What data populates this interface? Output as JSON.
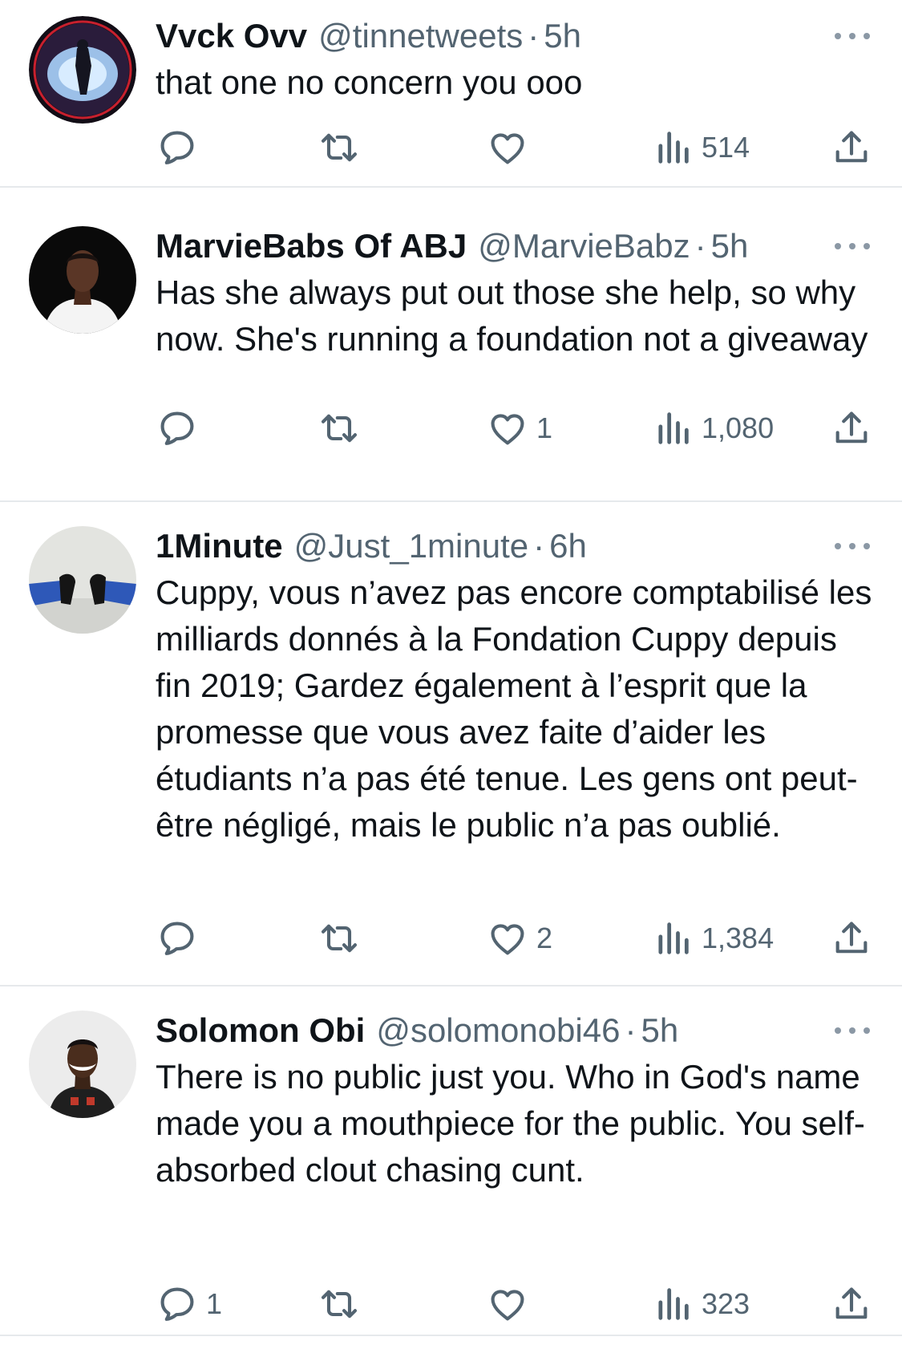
{
  "tweets": [
    {
      "name": "Vvck Ovv",
      "handle": "@tinnetweets",
      "separator": "·",
      "time": "5h",
      "text": "that one no concern you ooo",
      "replies": "",
      "retweets": "",
      "likes": "",
      "views": "514"
    },
    {
      "name": "MarvieBabs Of ABJ",
      "handle": "@MarvieBabz",
      "separator": "·",
      "time": "5h",
      "text": "Has she always put out those she help, so why now. She's running a foundation not a giveaway",
      "replies": "",
      "retweets": "",
      "likes": "1",
      "views": "1,080"
    },
    {
      "name": "1Minute",
      "handle": "@Just_1minute",
      "separator": "·",
      "time": "6h",
      "text": "Cuppy, vous n’avez pas encore comptabilisé les milliards donnés à la Fondation Cuppy depuis fin 2019; Gardez également à l’esprit que la promesse que vous avez faite d’aider les étudiants n’a pas été tenue. Les gens ont peut-être négligé, mais le public n’a pas oublié.",
      "replies": "",
      "retweets": "",
      "likes": "2",
      "views": "1,384"
    },
    {
      "name": "Solomon Obi",
      "handle": "@solomonobi46",
      "separator": "·",
      "time": "5h",
      "text": "There is no public just you. Who in God's name made you a mouthpiece for the public. You self-absorbed clout chasing cunt.",
      "replies": "1",
      "retweets": "",
      "likes": "",
      "views": "323"
    }
  ],
  "icons": {
    "reply": "reply-icon",
    "retweet": "retweet-icon",
    "like": "heart-icon",
    "views": "views-icon",
    "share": "share-icon",
    "more": "more-icon"
  },
  "colors": {
    "text": "#0f1419",
    "secondary": "#536471",
    "divider": "#e6e9ec"
  }
}
